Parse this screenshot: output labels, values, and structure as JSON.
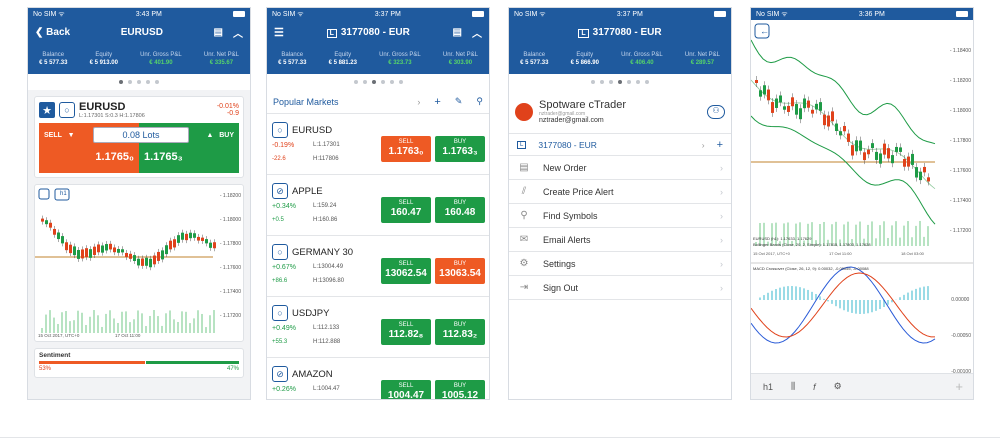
{
  "screens": [
    {
      "status": {
        "carrier": "No SIM ᯤ",
        "time": "3:43 PM"
      },
      "nav": {
        "back": "Back",
        "title": "EURUSD"
      },
      "balance": [
        {
          "label": "Balance",
          "value": "€ 5 577.33"
        },
        {
          "label": "Equity",
          "value": "€ 5 913.00"
        },
        {
          "label": "Unr. Gross P&L",
          "value": "€ 401.90"
        },
        {
          "label": "Unr. Net P&L",
          "value": "€ 335.67"
        }
      ],
      "symbol": {
        "name": "EURUSD",
        "info": "L:1.17301   S:0.3   H:1.17806",
        "change_pct": "-0.01%",
        "change_abs": "-0.9"
      },
      "trade": {
        "sell_label": "SELL",
        "buy_label": "BUY",
        "lots": "0.08 Lots",
        "sell_price": "1.1765₀",
        "buy_price": "1.1765₃"
      },
      "chart": {
        "timeframe": "h1",
        "date_label": "15 Oct 2017, UTC+0",
        "date_label2": "17 Oct 11:00",
        "price_ticks": [
          "1.18200",
          "1.18000",
          "1.17800",
          "1.17600",
          "1.17400",
          "1.17200"
        ]
      },
      "sentiment": {
        "title": "Sentiment",
        "sell_pct": "53%",
        "buy_pct": "47%",
        "sell_share": 0.53
      }
    },
    {
      "status": {
        "carrier": "No SIM ᯤ",
        "time": "3:37 PM"
      },
      "nav": {
        "title": "3177080 - EUR"
      },
      "balance": [
        {
          "label": "Balance",
          "value": "€ 5 577.33"
        },
        {
          "label": "Equity",
          "value": "€ 5 881.23"
        },
        {
          "label": "Unr. Gross P&L",
          "value": "€ 323.73"
        },
        {
          "label": "Unr. Net P&L",
          "value": "€ 303.90"
        }
      ],
      "section": "Popular Markets",
      "markets": [
        {
          "name": "EURUSD",
          "chg_pct": "-0.19%",
          "chg_abs": "-22.6",
          "low": "L:1.17301",
          "high": "H:117806",
          "sell": "1.1763₀",
          "buy": "1.1763₃",
          "up": false
        },
        {
          "name": "APPLE",
          "chg_pct": "+0.34%",
          "chg_abs": "+0.5",
          "low": "L:159.24",
          "high": "H:160.86",
          "sell": "160.47",
          "buy": "160.48",
          "up": true
        },
        {
          "name": "GERMANY 30",
          "chg_pct": "+0.67%",
          "chg_abs": "+86.6",
          "low": "L:13004.49",
          "high": "H:13096.80",
          "sell": "13062.54",
          "buy": "13063.54",
          "up": true
        },
        {
          "name": "USDJPY",
          "chg_pct": "+0.49%",
          "chg_abs": "+55.3",
          "low": "L:112.133",
          "high": "H:112.888",
          "sell": "112.82₈",
          "buy": "112.83₂",
          "up": true
        },
        {
          "name": "AMAZON",
          "chg_pct": "+0.26%",
          "chg_abs": "",
          "low": "L:1004.47",
          "high": "",
          "sell": "1004.47",
          "buy": "1005.12",
          "up": true
        }
      ],
      "sell_label": "SELL",
      "buy_label": "BUY"
    },
    {
      "status": {
        "carrier": "No SIM ᯤ",
        "time": "3:37 PM"
      },
      "nav": {
        "title": "3177080 - EUR"
      },
      "balance": [
        {
          "label": "Balance",
          "value": "€ 5 577.33"
        },
        {
          "label": "Equity",
          "value": "€ 5 866.90"
        },
        {
          "label": "Unr. Gross P&L",
          "value": "€ 406.40"
        },
        {
          "label": "Unr. Net P&L",
          "value": "€ 289.57"
        }
      ],
      "brand": "Spotware cTrader",
      "email_small": "nztrader@gmail.com",
      "email": "nztrader@gmail.com",
      "account": "3177080 - EUR",
      "menu": [
        "New Order",
        "Create Price Alert",
        "Find Symbols",
        "Email Alerts",
        "Settings",
        "Sign Out"
      ]
    },
    {
      "status": {
        "carrier": "No SIM ᯤ",
        "time": "3:36 PM"
      },
      "price_ticks": [
        "1.18400",
        "1.18200",
        "1.18000",
        "1.17800",
        "1.17600",
        "1.17400",
        "1.17200"
      ],
      "indicator1": "EURUSD (h1): 1.17633, 1.17629",
      "indicator2": "Bollinger Bands (Close, 20, 2, Simple): 1.17815, 1.17803, 1.17628",
      "date1": "15 Oct 2017, UTC+0",
      "date2": "17 Oct 11:00",
      "date3": "18 Oct 03:00",
      "macd": "MACD Crossover (Close, 26, 12, 9): 0.00032, -0.00055, -0.00088",
      "macd_ticks": [
        "0.00000",
        "-0.00050",
        "-0.00100"
      ],
      "toolbar": "h1"
    }
  ]
}
